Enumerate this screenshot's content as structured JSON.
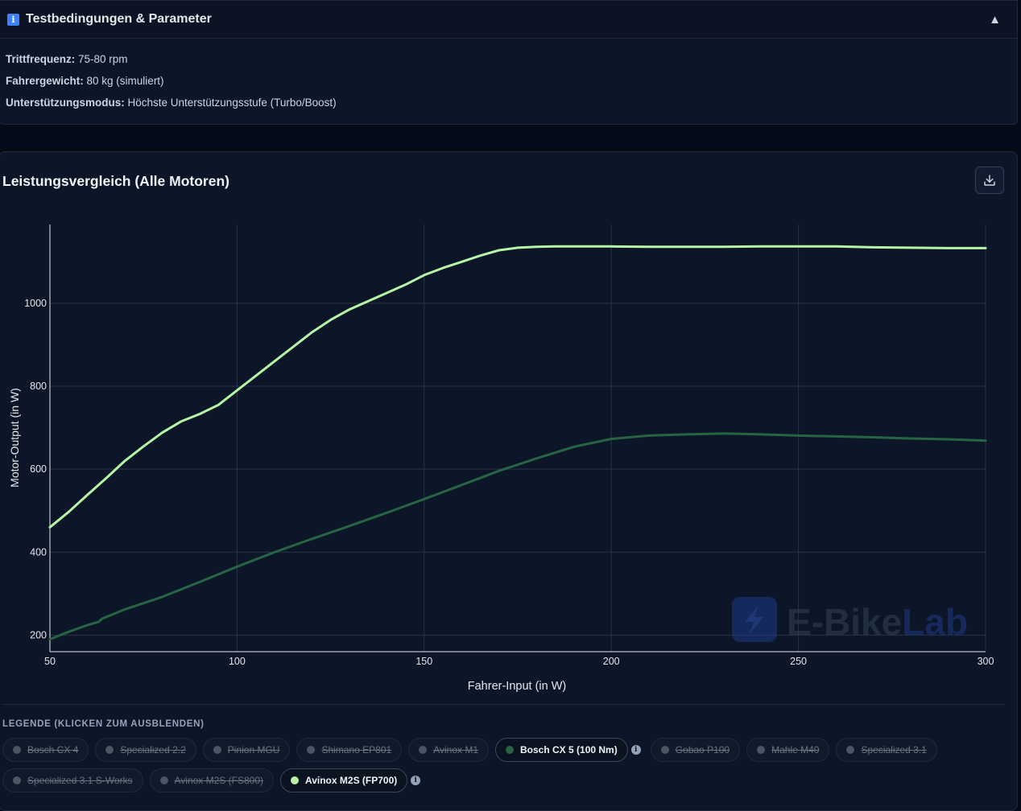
{
  "info": {
    "title": "Testbedingungen & Parameter",
    "icon": "info-icon",
    "rows": [
      {
        "label": "Trittfrequenz:",
        "value": " 75-80 rpm"
      },
      {
        "label": "Fahrergewicht:",
        "value": " 80 kg (simuliert)"
      },
      {
        "label": "Unterstützungsmodus:",
        "value": " Höchste Unterstützungsstufe (Turbo/Boost)"
      }
    ]
  },
  "chart": {
    "title": "Leistungsvergleich (Alle Motoren)",
    "watermark": {
      "e": "E-",
      "bike": "Bike",
      "lab": "Lab"
    }
  },
  "legend": {
    "title": "LEGENDE (KLICKEN ZUM AUSBLENDEN)",
    "items": [
      {
        "label": "Bosch CX 4",
        "active": false
      },
      {
        "label": "Specialized 2.2",
        "active": false
      },
      {
        "label": "Pinion MGU",
        "active": false
      },
      {
        "label": "Shimano EP801",
        "active": false
      },
      {
        "label": "Avinox M1",
        "active": false
      },
      {
        "label": "Bosch CX 5 (100 Nm)",
        "active": true,
        "color": "#276443",
        "info": true
      },
      {
        "label": "Gobao P100",
        "active": false
      },
      {
        "label": "Mahle M40",
        "active": false
      },
      {
        "label": "Specialized 3.1",
        "active": false
      },
      {
        "label": "Specialized 3.1 S-Works",
        "active": false
      },
      {
        "label": "Avinox M2S (FS800)",
        "active": false
      },
      {
        "label": "Avinox M2S (FP700)",
        "active": true,
        "color": "#b4f5a6",
        "info": true
      }
    ]
  },
  "chart_data": {
    "type": "line",
    "xlabel": "Fahrer-Input (in W)",
    "ylabel": "Motor-Output (in W)",
    "xlim": [
      50,
      300
    ],
    "ylim": [
      160,
      1190
    ],
    "xticks": [
      50,
      100,
      150,
      200,
      250,
      300
    ],
    "yticks": [
      200,
      400,
      600,
      800,
      1000
    ],
    "grid": true,
    "series": [
      {
        "name": "Bosch CX 5 (100 Nm)",
        "color": "#276443",
        "x": [
          50,
          55,
          60,
          63,
          64,
          70,
          80,
          90,
          100,
          110,
          120,
          130,
          140,
          150,
          160,
          170,
          180,
          190,
          200,
          210,
          220,
          230,
          240,
          250,
          260,
          270,
          280,
          290,
          300
        ],
        "y": [
          190,
          208,
          224,
          232,
          240,
          262,
          292,
          328,
          365,
          400,
          432,
          463,
          495,
          528,
          562,
          596,
          626,
          654,
          673,
          681,
          684,
          686,
          684,
          681,
          679,
          677,
          674,
          672,
          669
        ]
      },
      {
        "name": "Avinox M2S (FP700)",
        "color": "#b4f5a6",
        "x": [
          50,
          55,
          60,
          65,
          70,
          75,
          80,
          85,
          90,
          95,
          100,
          105,
          110,
          115,
          120,
          125,
          130,
          135,
          140,
          145,
          150,
          155,
          160,
          165,
          170,
          175,
          180,
          185,
          190,
          200,
          210,
          220,
          230,
          240,
          250,
          260,
          270,
          280,
          290,
          300
        ],
        "y": [
          460,
          497,
          538,
          578,
          620,
          655,
          688,
          715,
          733,
          755,
          790,
          825,
          860,
          895,
          930,
          960,
          985,
          1005,
          1025,
          1045,
          1068,
          1085,
          1100,
          1115,
          1128,
          1134,
          1136,
          1137,
          1137,
          1137,
          1136,
          1136,
          1136,
          1137,
          1137,
          1137,
          1135,
          1134,
          1133,
          1133
        ]
      }
    ]
  }
}
